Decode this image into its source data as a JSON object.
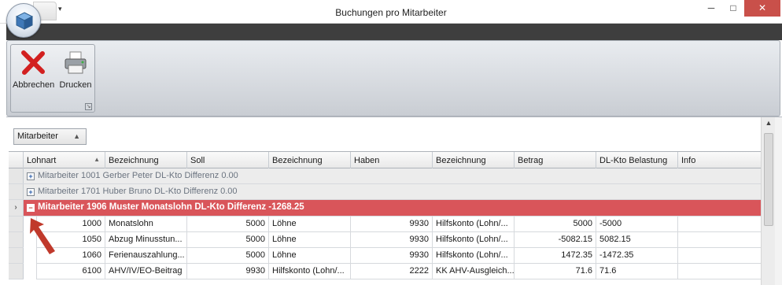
{
  "window": {
    "title": "Buchungen pro Mitarbeiter",
    "quick_access_dropdown": "▾",
    "min": "─",
    "max": "□",
    "close": "✕"
  },
  "ribbon": {
    "buttons": [
      {
        "label": "Abbrechen",
        "icon": "cancel-x-icon"
      },
      {
        "label": "Drucken",
        "icon": "printer-icon"
      }
    ],
    "launcher": "↘"
  },
  "groupby": {
    "chip_label": "Mitarbeiter",
    "sort_icon": "▲"
  },
  "grid": {
    "columns": [
      "Lohnart",
      "Bezeichnung",
      "Soll",
      "Bezeichnung",
      "Haben",
      "Bezeichnung",
      "Betrag",
      "DL-Kto Belastung",
      "Info"
    ],
    "sort_icon": "▲",
    "groups": [
      {
        "text": "Mitarbeiter 1001 Gerber Peter DL-Kto Differenz 0.00",
        "expander": "+"
      },
      {
        "text": "Mitarbeiter 1701 Huber Bruno DL-Kto Differenz 0.00",
        "expander": "+"
      },
      {
        "text": "Mitarbeiter 1906 Muster Monatslohn DL-Kto Differenz -1268.25",
        "expander": "−",
        "indicator": "›"
      }
    ],
    "rows": [
      {
        "lohnart": "1000",
        "bez1": "Monatslohn",
        "soll": "5000",
        "bez2": "Löhne",
        "haben": "9930",
        "bez3": "Hilfskonto (Lohn/...",
        "betrag": "5000",
        "dl": "-5000",
        "info": ""
      },
      {
        "lohnart": "1050",
        "bez1": "Abzug Minusstun...",
        "soll": "5000",
        "bez2": "Löhne",
        "haben": "9930",
        "bez3": "Hilfskonto (Lohn/...",
        "betrag": "-5082.15",
        "dl": "5082.15",
        "info": ""
      },
      {
        "lohnart": "1060",
        "bez1": "Ferienauszahlung...",
        "soll": "5000",
        "bez2": "Löhne",
        "haben": "9930",
        "bez3": "Hilfskonto (Lohn/...",
        "betrag": "1472.35",
        "dl": "-1472.35",
        "info": ""
      },
      {
        "lohnart": "6100",
        "bez1": "AHV/IV/EO-Beitrag",
        "soll": "9930",
        "bez2": "Hilfskonto (Lohn/...",
        "haben": "2222",
        "bez3": "KK AHV-Ausgleich...",
        "betrag": "71.6",
        "dl": "71.6",
        "info": ""
      }
    ]
  },
  "colors": {
    "selected_group": "#d9555a",
    "close_button": "#c9504a",
    "annotation_arrow": "#c0392b"
  }
}
